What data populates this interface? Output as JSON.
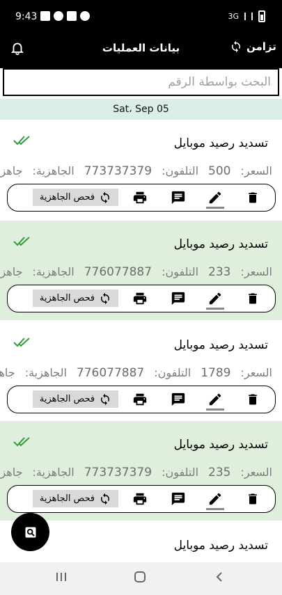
{
  "status": {
    "time": "9:43",
    "network": "3G"
  },
  "app_bar": {
    "title": "بيانات العمليات",
    "sync_label": "تزامن"
  },
  "search": {
    "placeholder": "البحث بواسطة الرقم"
  },
  "date_header": "Sat، Sep 05",
  "labels": {
    "price": "السعر:",
    "phone": "التلفون:",
    "readiness": "الجاهزية:",
    "check_readiness": "فحص الجاهزية"
  },
  "operations": [
    {
      "title": "تسديد رصيد موبايل",
      "price": "500",
      "phone": "773737379",
      "readiness": "جاهز"
    },
    {
      "title": "تسديد رصيد موبايل",
      "price": "233",
      "phone": "776077887",
      "readiness": "جاهز"
    },
    {
      "title": "تسديد رصيد موبايل",
      "price": "1789",
      "phone": "776077887",
      "readiness": "جاهز"
    },
    {
      "title": "تسديد رصيد موبايل",
      "price": "235",
      "phone": "773737379",
      "readiness": "جاهز"
    },
    {
      "title": "تسديد رصيد موبايل"
    }
  ],
  "colors": {
    "bar": "#000000",
    "card_alt": "#e0eedc",
    "date_bar": "#daeee6",
    "check": "#2e9e3e"
  },
  "icons": [
    "bell-icon",
    "sync-icon",
    "double-check-icon",
    "delete-icon",
    "edit-icon",
    "message-icon",
    "print-icon",
    "refresh-icon",
    "search-fab-icon"
  ]
}
